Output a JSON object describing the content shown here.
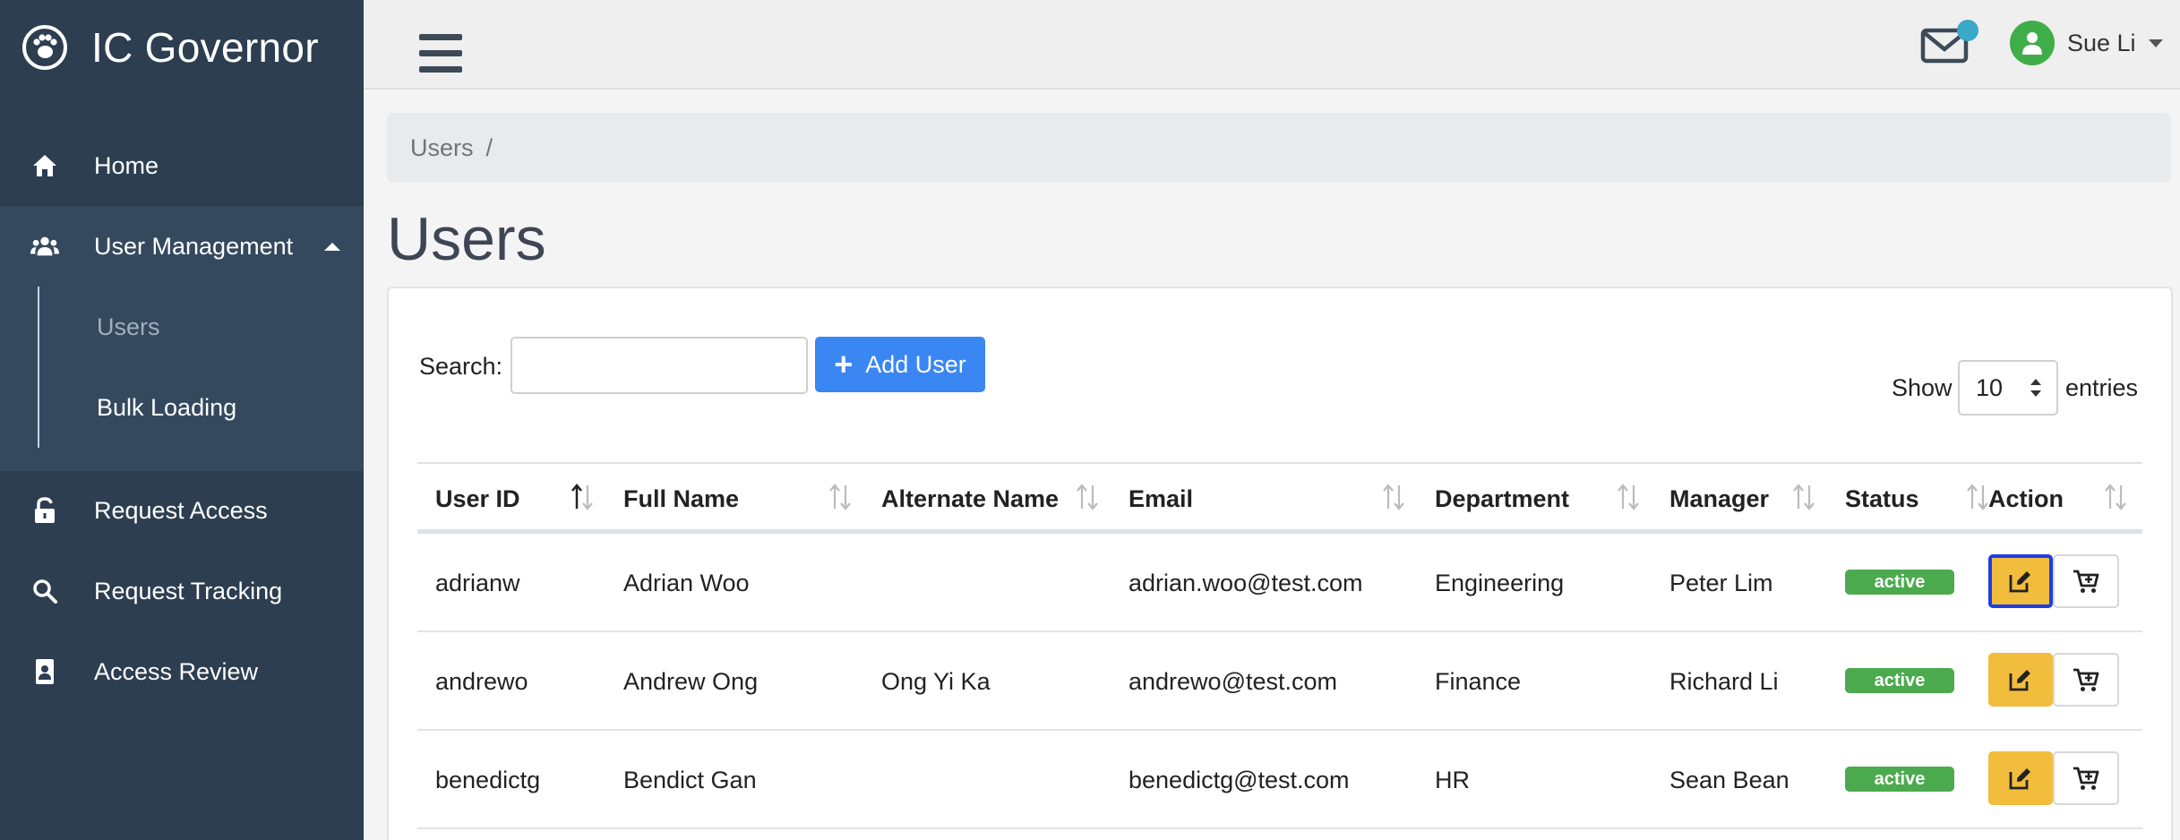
{
  "app": {
    "title": "IC Governor"
  },
  "sidebar": {
    "items": [
      {
        "label": "Home",
        "icon": "home-icon"
      },
      {
        "label": "User Management",
        "icon": "users-icon"
      },
      {
        "label": "Request Access",
        "icon": "unlock-icon"
      },
      {
        "label": "Request Tracking",
        "icon": "search-icon"
      },
      {
        "label": "Access Review",
        "icon": "id-badge-icon"
      }
    ],
    "user_management_sub": [
      {
        "label": "Users",
        "active": true
      },
      {
        "label": "Bulk Loading",
        "active": false
      }
    ]
  },
  "topbar": {
    "user_name": "Sue Li",
    "notification_color": "#3aa8c7"
  },
  "breadcrumb": {
    "items": [
      "Users"
    ],
    "separator": "/"
  },
  "page": {
    "title": "Users"
  },
  "toolbar": {
    "search_label": "Search:",
    "search_value": "",
    "add_user_label": "Add User",
    "show_label": "Show",
    "entries_value": "10",
    "entries_label": "entries"
  },
  "table": {
    "columns": [
      "User ID",
      "Full Name",
      "Alternate Name",
      "Email",
      "Department",
      "Manager",
      "Status",
      "Action"
    ],
    "rows": [
      {
        "user_id": "adrianw",
        "full_name": "Adrian Woo",
        "alternate_name": "",
        "email": "adrian.woo@test.com",
        "department": "Engineering",
        "manager": "Peter Lim",
        "status": "active"
      },
      {
        "user_id": "andrewo",
        "full_name": "Andrew Ong",
        "alternate_name": "Ong Yi Ka",
        "email": "andrewo@test.com",
        "department": "Finance",
        "manager": "Richard Li",
        "status": "active"
      },
      {
        "user_id": "benedictg",
        "full_name": "Bendict Gan",
        "alternate_name": "",
        "email": "benedictg@test.com",
        "department": "HR",
        "manager": "Sean Bean",
        "status": "active"
      }
    ]
  },
  "colors": {
    "sidebar": "#2c3e50",
    "primary": "#3a86f3",
    "edit": "#f2bd3c",
    "active_badge": "#4caa4e"
  }
}
